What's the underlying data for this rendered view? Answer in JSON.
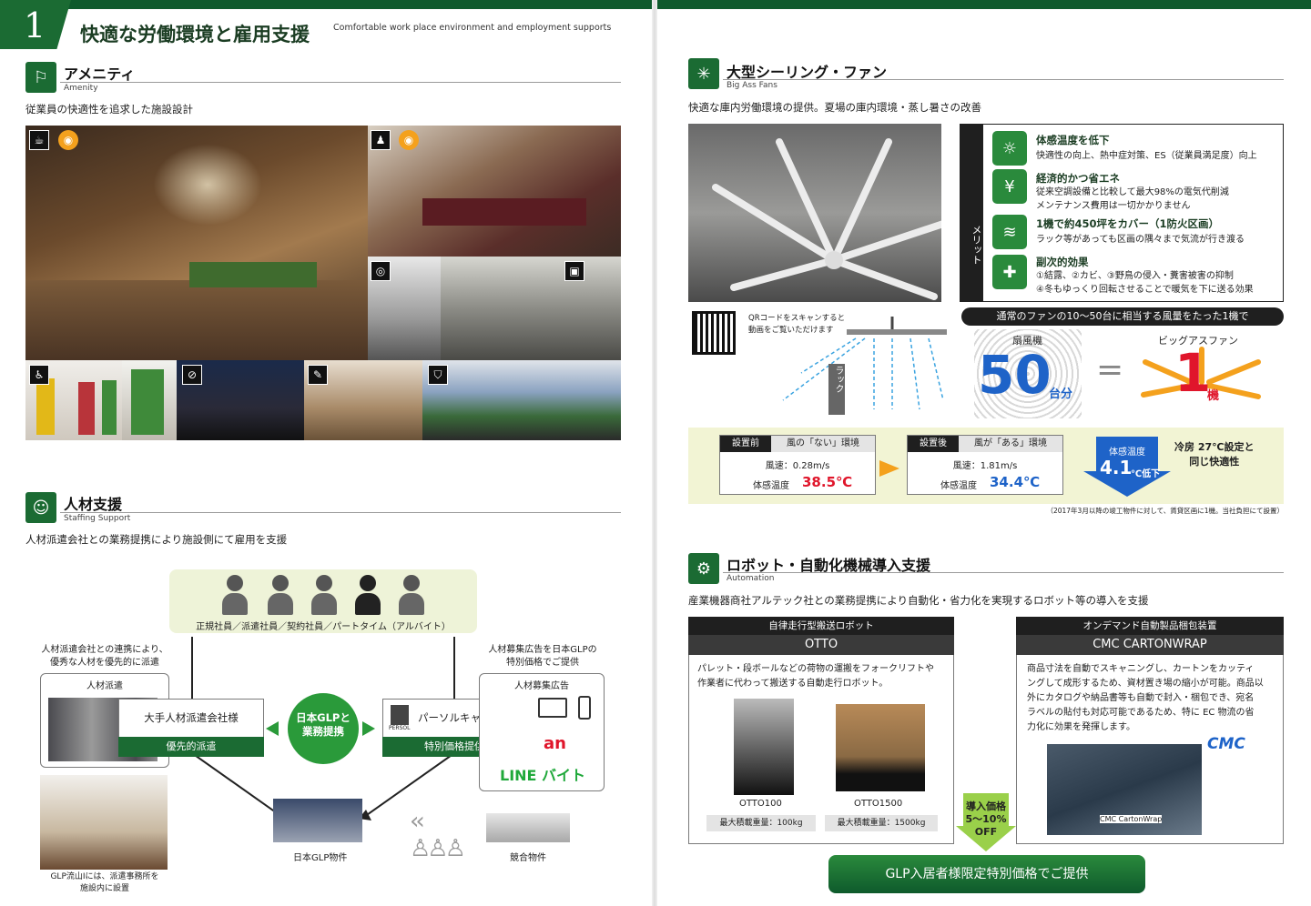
{
  "header": {
    "number": "1",
    "title": "快適な労働環境と雇用支援",
    "subtitle": "Comfortable work place environment and employment supports"
  },
  "amenity": {
    "title": "アメニティ",
    "sub": "Amenity",
    "desc": "従業員の快適性を追求した施設設計",
    "icon": "chair-table-icon"
  },
  "staffing": {
    "title": "人材支援",
    "sub": "Staffing Support",
    "desc": "人材派遣会社との業務提携により施設側にて雇用を支援",
    "workers_caption": "正規社員／派遣社員／契約社員／パートタイム（アルバイト）",
    "left_note": "人材派遣会社との連携により、\n優秀な人材を優先的に派遣",
    "right_note": "人材募集広告を日本GLPの\n特別価格でご提供",
    "haken_label": "人材派遣",
    "haken_company": "大手人材派遣会社様",
    "haken_tag": "優先的派遣",
    "center_badge": "日本GLPと\n業務提携",
    "persol_logo": "PERSOL",
    "persol_company": "パーソルキャリア様",
    "persol_tag": "特別価格提供",
    "ad_label": "人材募集広告",
    "an_logo": "an",
    "line_logo": "LINE バイト",
    "glp_property": "日本GLP物件",
    "competitor": "競合物件",
    "photo_caption": "GLP流山Ⅰには、派遣事務所を\n施設内に設置"
  },
  "fan": {
    "title": "大型シーリング・ファン",
    "sub": "Big Ass Fans",
    "desc": "快適な庫内労働環境の提供。夏場の庫内環境・蒸し暑さの改善",
    "merit_label": "メリット",
    "merits": [
      {
        "h": "体感温度を低下",
        "t": "快適性の向上、熱中症対策、ES（従業員満足度）向上",
        "icon": "thermometer-icon"
      },
      {
        "h": "経済的かつ省エネ",
        "t": "従来空調設備と比較して最大98%の電気代削減\nメンテナンス費用は一切かかりません",
        "icon": "coins-icon"
      },
      {
        "h": "1機で約450坪をカバー（1防火区画）",
        "t": "ラック等があっても区画の隅々まで気流が行き渡る",
        "icon": "airflow-icon"
      },
      {
        "h": "副次的効果",
        "t": "①結露、②カビ、③野鳥の侵入・糞害被害の抑制\n④冬もゆっくり回転させることで暖気を下に送る効果",
        "icon": "plus-icon"
      }
    ],
    "qr_text": "QRコードをスキャンすると\n動画をご覧いただけます",
    "rack_label": "ラック",
    "banner": "通常のファンの10〜50台に相当する風量をたった1機で",
    "fan_label": "扇風機",
    "fan_count": "50",
    "fan_unit": "台分",
    "equals": "=",
    "big_label": "ビッグアスファン",
    "big_count": "1",
    "big_unit": "機",
    "before_tag": "設置前",
    "before_title": "風の「ない」環境",
    "before_speed": "風速：0.28m/s",
    "before_temp_label": "体感温度",
    "before_temp": "38.5℃",
    "after_tag": "設置後",
    "after_title": "風が「ある」環境",
    "after_speed": "風速：1.81m/s",
    "after_temp_label": "体感温度",
    "after_temp": "34.4℃",
    "drop_label": "体感温度",
    "drop_value": "4.1",
    "drop_unit": "℃低下",
    "aircon_note": "冷房 27℃設定と\n同じ快適性",
    "footnote": "（2017年3月以降の竣工物件に対して、賃貸区画に1機。当社負担にて設置）"
  },
  "robot": {
    "title": "ロボット・自動化機械導入支援",
    "sub": "Automation",
    "desc": "産業機器商社アルテック社との業務提携により自動化・省力化を実現するロボット等の導入を支援",
    "otto_head": "自律走行型搬送ロボット",
    "otto_name": "OTTO",
    "otto_desc": "パレット・段ボールなどの荷物の運搬をフォークリフトや\n作業者に代わって搬送する自動走行ロボット。",
    "otto100": "OTTO100",
    "otto100_load": "最大積載重量：100kg",
    "otto1500": "OTTO1500",
    "otto1500_load": "最大積載重量：1500kg",
    "price_tag": "導入価格\n5〜10%\nOFF",
    "cmc_head": "オンデマンド自動製品梱包装置",
    "cmc_name": "CMC CARTONWRAP",
    "cmc_desc": "商品寸法を自動でスキャニングし、カートンをカッティ\nングして成形するため、資材置き場の縮小が可能。商品以\n外にカタログや納品書等も自動で封入・梱包でき、宛名\nラベルの貼付も対応可能であるため、特に EC 物流の省\n力化に効果を発揮します。",
    "cmc_logo": "CMC",
    "cmc_machine_label": "CMC CartonWrap",
    "button": "GLP入居者様限定特別価格でご提供"
  },
  "colors": {
    "brand_green": "#1b6b33",
    "dark_green": "#0e5a2c",
    "accent_red": "#e0162b",
    "accent_blue": "#1e63c8",
    "accent_orange": "#f4a11d"
  }
}
